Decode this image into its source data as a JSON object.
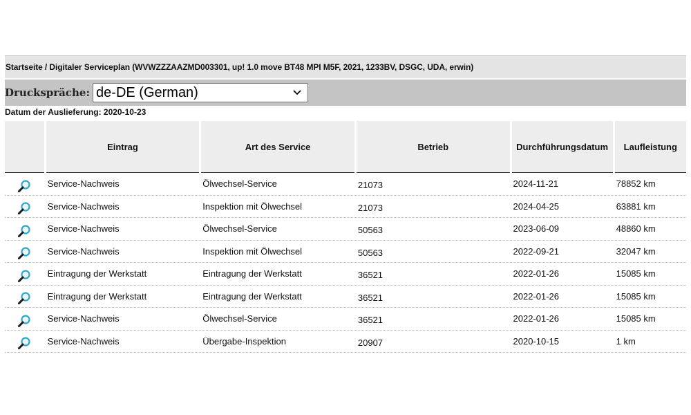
{
  "breadcrumb": "Startseite / Digitaler Serviceplan (WVWZZZAAZMD003301, up! 1.0 move BT48 MPI M5F, 2021, 1233BV, DSGC, UDA, erwin)",
  "print_language": {
    "label": "Druckspräche:",
    "selected": "de-DE (German)"
  },
  "delivery_date": "Datum der Auslieferung: 2020-10-23",
  "table": {
    "headers": [
      "",
      "Eintrag",
      "Art des Service",
      "Betrieb",
      "Durchführungsdatum",
      "Laufleistung"
    ],
    "rows": [
      {
        "icon": "magnifier-icon",
        "entry": "Service-Nachweis",
        "service": "Ölwechsel-Service",
        "workshop": "21073",
        "date": "2024-11-21",
        "mileage": "78852 km"
      },
      {
        "icon": "magnifier-icon",
        "entry": "Service-Nachweis",
        "service": "Inspektion mit Ölwechsel",
        "workshop": "21073",
        "date": "2024-04-25",
        "mileage": "63881 km"
      },
      {
        "icon": "magnifier-icon",
        "entry": "Service-Nachweis",
        "service": "Ölwechsel-Service",
        "workshop": "50563",
        "date": "2023-06-09",
        "mileage": "48860 km"
      },
      {
        "icon": "magnifier-icon",
        "entry": "Service-Nachweis",
        "service": "Inspektion mit Ölwechsel",
        "workshop": "50563",
        "date": "2022-09-21",
        "mileage": "32047 km"
      },
      {
        "icon": "magnifier-icon",
        "entry": "Eintragung der Werkstatt",
        "service": "Eintragung der Werkstatt",
        "workshop": "36521",
        "date": "2022-01-26",
        "mileage": "15085 km"
      },
      {
        "icon": "magnifier-icon",
        "entry": "Eintragung der Werkstatt",
        "service": "Eintragung der Werkstatt",
        "workshop": "36521",
        "date": "2022-01-26",
        "mileage": "15085 km"
      },
      {
        "icon": "magnifier-icon",
        "entry": "Service-Nachweis",
        "service": "Ölwechsel-Service",
        "workshop": "36521",
        "date": "2022-01-26",
        "mileage": "15085 km"
      },
      {
        "icon": "magnifier-icon",
        "entry": "Service-Nachweis",
        "service": "Übergabe-Inspektion",
        "workshop": "20907",
        "date": "2020-10-15",
        "mileage": "1 km"
      }
    ]
  },
  "colors": {
    "header_bg": "#ededed",
    "breadcrumb_bg": "#e4e4e4",
    "language_bar_bg": "#c4c4c4",
    "icon_lens": "#2fa7c9",
    "icon_handle": "#1a1a1a"
  }
}
